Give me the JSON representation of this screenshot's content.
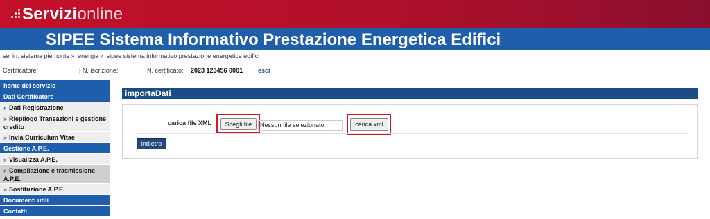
{
  "brand": {
    "bold": "Servizi",
    "light": "online"
  },
  "header": {
    "title": "SIPEE Sistema Informativo Prestazione Energetica Edifici"
  },
  "breadcrumb": {
    "prefix": "sei in:",
    "items": [
      "sistema piemonte",
      "energia",
      "sipee sistema informativo prestazione energetica edifici"
    ],
    "separator": "»"
  },
  "info": {
    "certificatore_label": "Certificatore:",
    "iscrizione_label": "| N. iscrizione:",
    "certificato_label": "N. certificato:",
    "certificato_value": "2023 123456 0001",
    "esci": "esci"
  },
  "sidebar": {
    "home": "home del servizio",
    "section1": "Dati Certificatore",
    "s1_items": [
      "Dati Registrazione",
      "Riepilogo Transazioni e gestione credito",
      "Invia Curriculum Vitae"
    ],
    "section2": "Gestione A.P.E.",
    "s2_items": [
      "Visualizza A.P.E.",
      "Compilazione e trasmissione A.P.E.",
      "Sostituzione A.P.E."
    ],
    "documenti": "Documenti utili",
    "contatti": "Contatti",
    "arrow": "»"
  },
  "panel": {
    "title": "importaDati",
    "file_label": "carica file XML",
    "choose_button": "Scegli file",
    "file_status": "Nessun file selezionato",
    "upload_button": "carica xml",
    "back_button": "indietro"
  },
  "colors": {
    "brand_red": "#c4102a",
    "brand_blue": "#1f5eab",
    "panel_blue": "#1a4c86",
    "highlight": "#d4142a"
  }
}
